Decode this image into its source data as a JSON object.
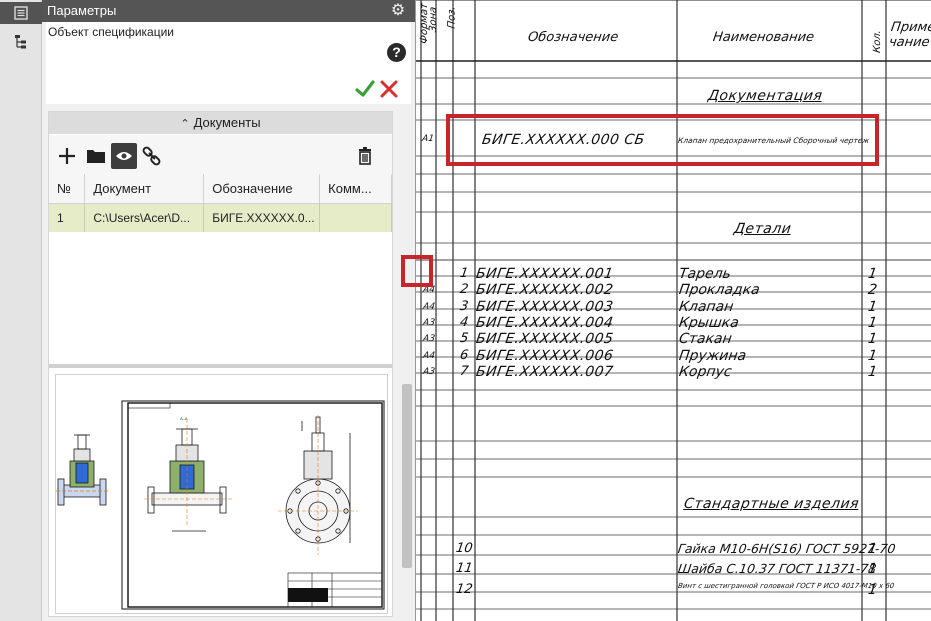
{
  "panel": {
    "title": "Параметры",
    "object_label": "Объект спецификации",
    "documents_toggle": "Документы",
    "table_headers": [
      "№",
      "Документ",
      "Обозначение",
      "Комм..."
    ],
    "rows": [
      {
        "num": "1",
        "document": "C:\\Users\\Acer\\D...",
        "designation": "БИГЕ.XXXXXX.0...",
        "comment": ""
      }
    ]
  },
  "icons": {
    "strip_params": "parameters-panel-icon",
    "strip_tree": "tree-icon",
    "settings": "gear-icon",
    "help": "help-icon",
    "ok": "checkmark-icon",
    "cancel": "close-icon",
    "add": "plus-icon",
    "open": "folder-icon",
    "view": "eye-icon",
    "link": "link-icon",
    "delete": "trash-icon"
  },
  "colors": {
    "ok": "#3aa13a",
    "cancel": "#d9302f",
    "highlight": "#c8252b",
    "selected_row": "#e6ecc8"
  },
  "spec": {
    "headers": {
      "format": "Формат",
      "zone": "Зона",
      "position": "Поз.",
      "designation": "Обозначение",
      "name": "Наименование",
      "quantity": "Кол.",
      "note": "Приме чание"
    },
    "sections": {
      "documentation": "Документация",
      "details": "Детали",
      "standard": "Стандартные изделия"
    },
    "doc_row": {
      "format": "А1",
      "designation": "БИГЕ.XXXXXX.000 СБ",
      "name": "Клапан предохранительный Сборочный чертеж"
    },
    "details": [
      {
        "format": "",
        "pos": "1",
        "designation": "БИГЕ.XXXXXX.001",
        "name": "Тарель",
        "qty": "1"
      },
      {
        "format": "А4",
        "pos": "2",
        "designation": "БИГЕ.XXXXXX.002",
        "name": "Прокладка",
        "qty": "2"
      },
      {
        "format": "А4",
        "pos": "3",
        "designation": "БИГЕ.XXXXXX.003",
        "name": "Клапан",
        "qty": "1"
      },
      {
        "format": "А3",
        "pos": "4",
        "designation": "БИГЕ.XXXXXX.004",
        "name": "Крышка",
        "qty": "1"
      },
      {
        "format": "А3",
        "pos": "5",
        "designation": "БИГЕ.XXXXXX.005",
        "name": "Стакан",
        "qty": "1"
      },
      {
        "format": "А4",
        "pos": "6",
        "designation": "БИГЕ.XXXXXX.006",
        "name": "Пружина",
        "qty": "1"
      },
      {
        "format": "А3",
        "pos": "7",
        "designation": "БИГЕ.XXXXXX.007",
        "name": "Корпус",
        "qty": "1"
      }
    ],
    "standard": [
      {
        "pos": "10",
        "name": "Гайка М10-6Н(S16) ГОСТ 5927-70",
        "qty": "1"
      },
      {
        "pos": "11",
        "name": "Шайба С.10.37 ГОСТ 11371-78",
        "qty": "1"
      },
      {
        "pos": "12",
        "name": "Винт с шестигранной головкой ГОСТ Р ИСО 4017-М10 х 60",
        "qty": "1"
      }
    ]
  }
}
